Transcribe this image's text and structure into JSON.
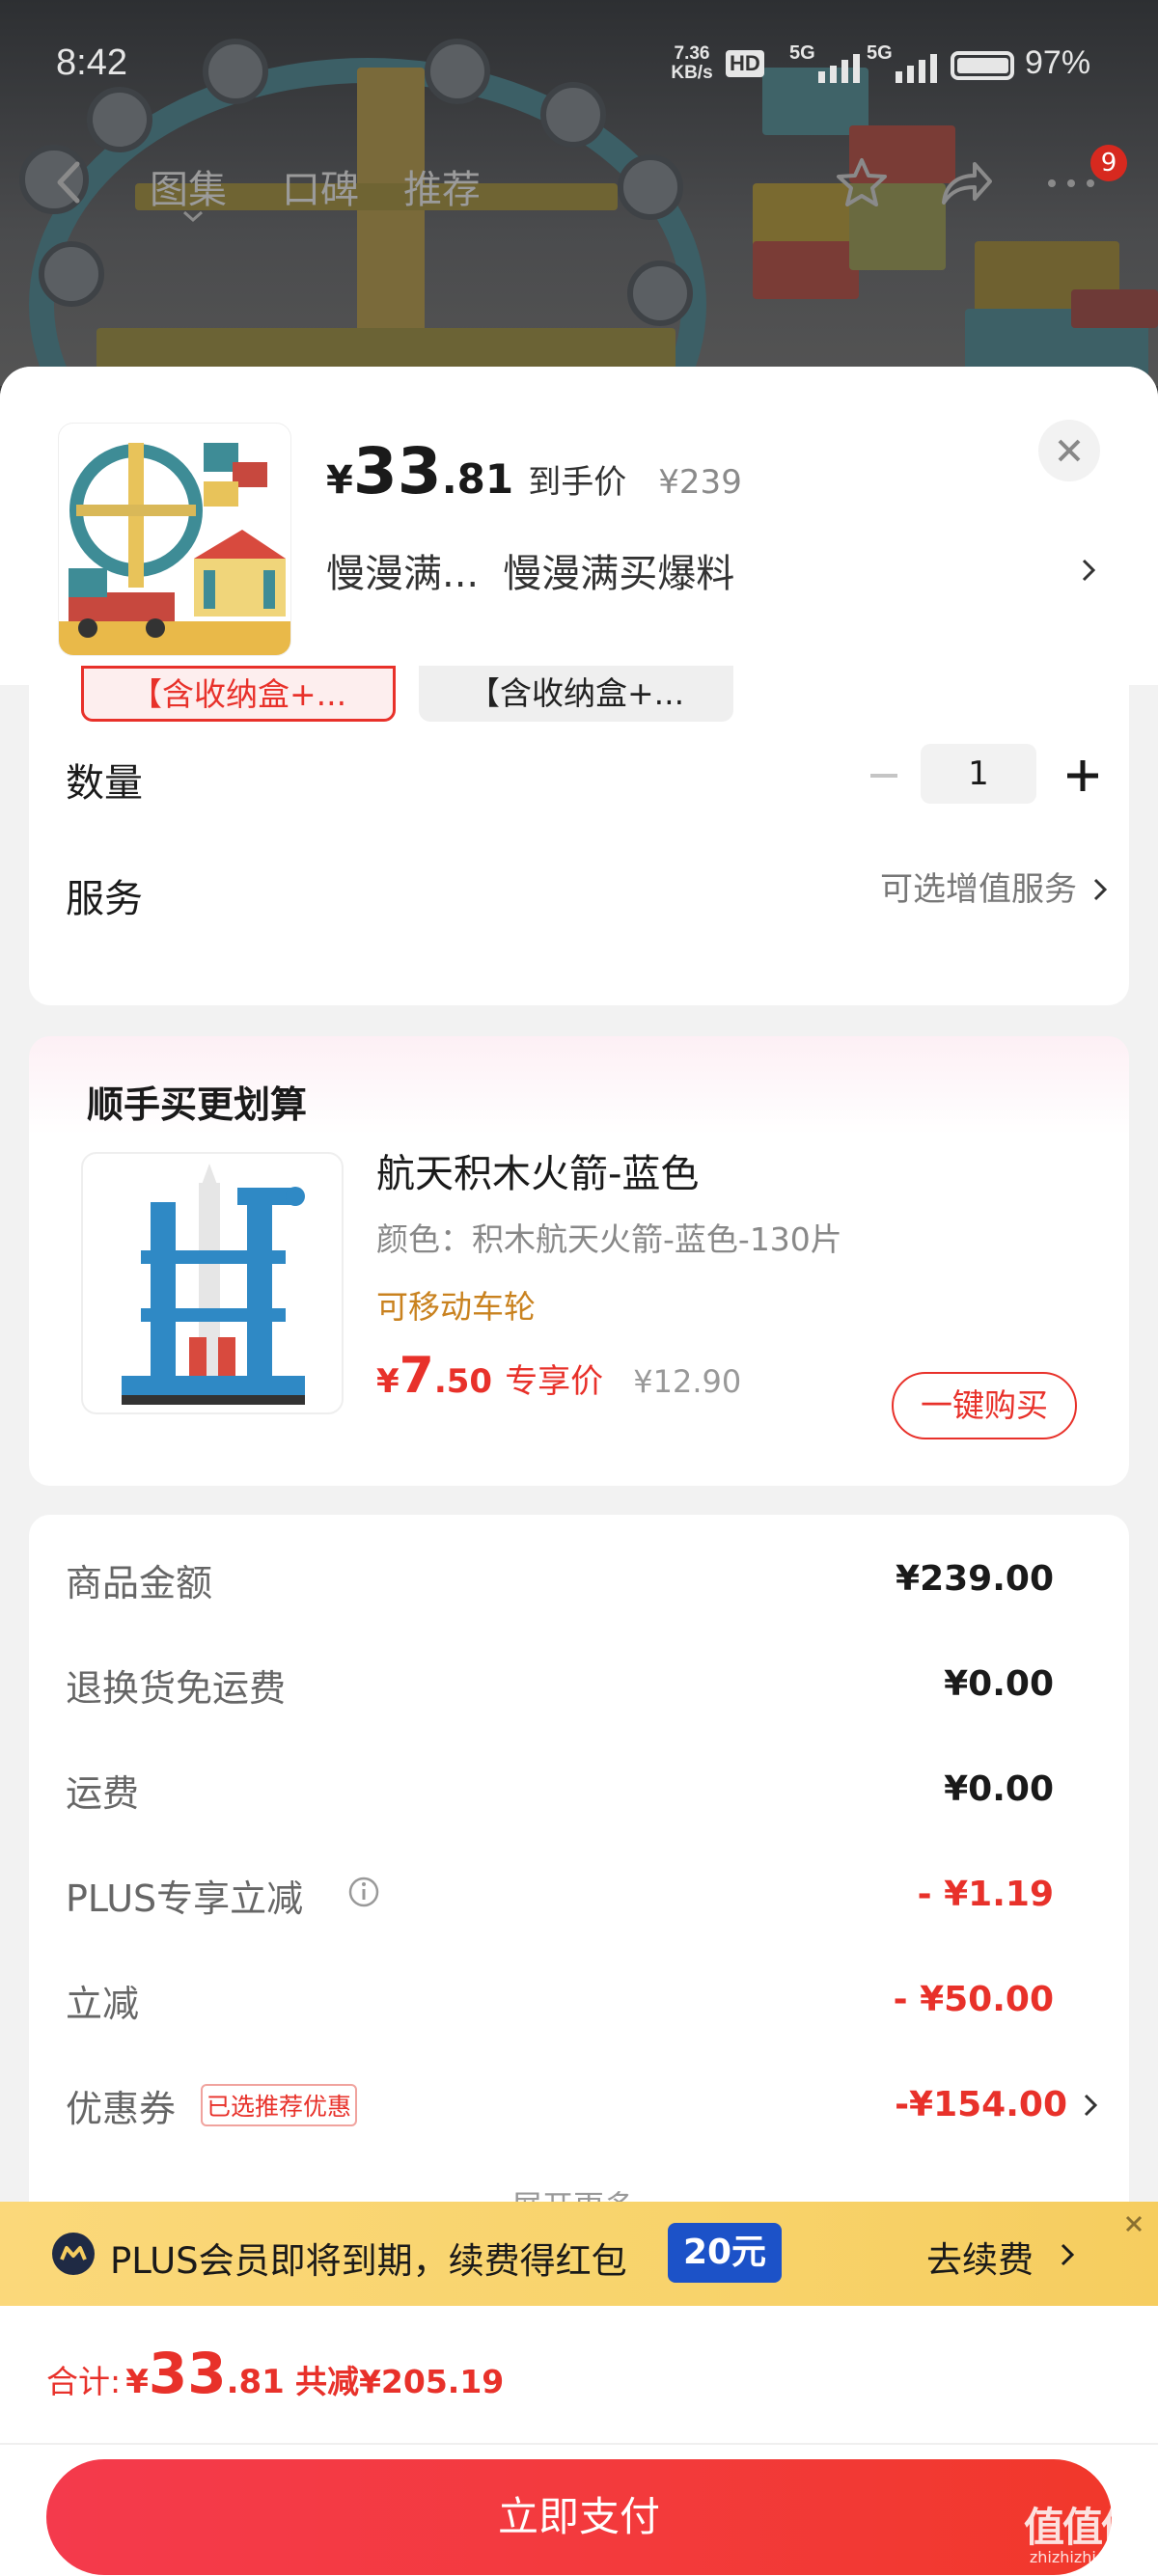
{
  "status_bar": {
    "time": "8:42",
    "net_speed_top": "7.36",
    "net_speed_bottom": "KB/s",
    "hd_badge": "HD",
    "sig1": "5G",
    "sig2": "5G",
    "battery": "97%"
  },
  "top_nav": {
    "tabs": [
      "图集",
      "口碑",
      "推荐"
    ],
    "message_badge": "9"
  },
  "product_header": {
    "price_currency": "¥",
    "price_int": "33",
    "price_dec": ".81",
    "price_tag": "到手价",
    "original_price": "¥239",
    "promo_short": "慢漫满...",
    "promo_text": "慢漫满买爆料"
  },
  "variants": [
    "【含收纳盒+...",
    "【含收纳盒+..."
  ],
  "quantity": {
    "label": "数量",
    "value": "1"
  },
  "service": {
    "label": "服务",
    "value": "可选增值服务"
  },
  "addon": {
    "section_title": "顺手买更划算",
    "item_title": "航天积木火箭-蓝色",
    "item_spec": "颜色：积木航天火箭-蓝色-130片",
    "item_tag": "可移动车轮",
    "price_currency": "¥",
    "price_int": "7",
    "price_dec": ".50",
    "price_tag": "专享价",
    "original_price": "¥12.90",
    "buy_button": "一键购买"
  },
  "cost_rows": [
    {
      "label": "商品金额",
      "value": "¥239.00"
    },
    {
      "label": "退换货免运费",
      "value": "¥0.00"
    },
    {
      "label": "运费",
      "value": "¥0.00"
    },
    {
      "label": "PLUS专享立减",
      "value": "- ¥1.19"
    },
    {
      "label": "立减",
      "value": "- ¥50.00"
    },
    {
      "label": "优惠券",
      "value": "-¥154.00",
      "badge": "已选推荐优惠"
    }
  ],
  "more_text": "展开更多",
  "plus_banner": {
    "text": "PLUS会员即将到期，续费得红包",
    "amount": "20元",
    "action": "去续费"
  },
  "total": {
    "label": "合计:",
    "currency": "¥",
    "int": "33",
    "dec": ".81",
    "saved": "共减¥205.19"
  },
  "pay_button": "立即支付",
  "watermark": {
    "big": "值值值",
    "small": "zhizhizhi.com"
  },
  "colors": {
    "accent_red": "#e8312a",
    "plus_yellow": "#f9d36c",
    "price_orange": "#c9821f"
  }
}
